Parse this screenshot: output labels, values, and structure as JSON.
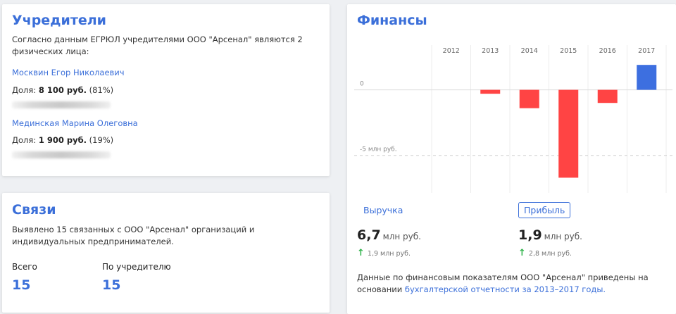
{
  "founders": {
    "title": "Учредители",
    "intro": "Согласно данным ЕГРЮЛ учредителями ООО \"Арсенал\" являются 2 физических лица:",
    "people": [
      {
        "name": "Москвин Егор Николаевич",
        "share_prefix": "Доля: ",
        "share_amount": "8 100 руб.",
        "share_pct": " (81%)"
      },
      {
        "name": "Мединская Марина Олеговна",
        "share_prefix": "Доля: ",
        "share_amount": "1 900 руб.",
        "share_pct": " (19%)"
      }
    ]
  },
  "links": {
    "title": "Связи",
    "text": "Выявлено 15 связанных с ООО \"Арсенал\" организаций и индивидуальных предпринимателей.",
    "total_label": "Всего",
    "total_value": "15",
    "by_founder_label": "По учредителю",
    "by_founder_value": "15"
  },
  "finance": {
    "title": "Финансы",
    "tab_revenue": "Выручка",
    "tab_profit": "Прибыль",
    "revenue_value": "6,7",
    "revenue_unit": "млн руб.",
    "revenue_delta": "1,9 млн руб.",
    "profit_value": "1,9",
    "profit_unit": "млн руб.",
    "profit_delta": "2,8 млн руб.",
    "note_text": "Данные по финансовым показателям ООО \"Арсенал\" приведены на основании ",
    "note_link": "бухгалтерской отчетности за 2013–2017 годы."
  },
  "chart_data": {
    "type": "bar",
    "categories": [
      "2012",
      "2013",
      "2014",
      "2015",
      "2016",
      "2017"
    ],
    "values": [
      0,
      -0.3,
      -1.4,
      -6.7,
      -1.0,
      1.9
    ],
    "ylim": [
      -7,
      2.5
    ],
    "y_ticks": [
      {
        "v": 0,
        "label": "0"
      },
      {
        "v": -5,
        "label": "-5 млн руб."
      }
    ],
    "colors": {
      "negative": "#ff4444",
      "positive": "#3d6fe0"
    }
  }
}
